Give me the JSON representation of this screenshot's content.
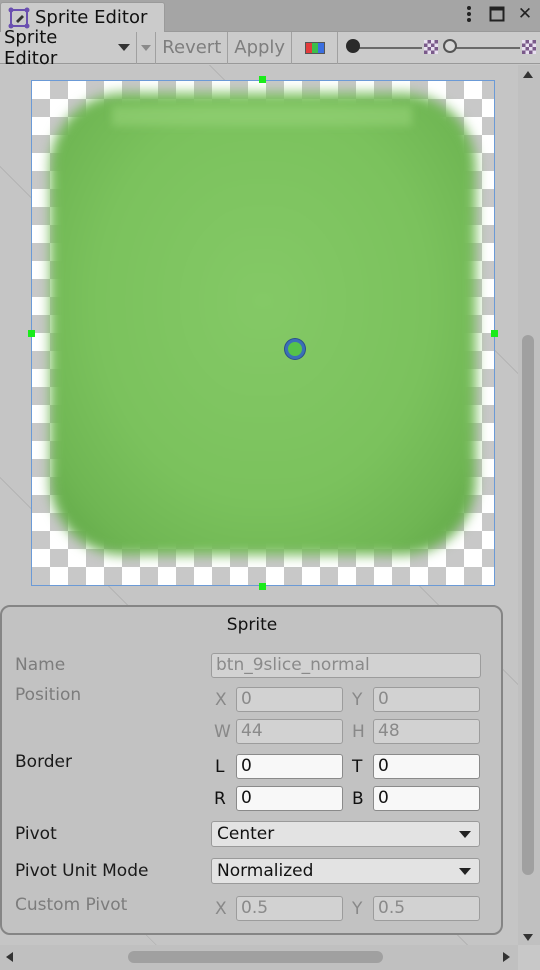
{
  "window": {
    "tab_title": "Sprite Editor",
    "icons": [
      "sprite-editor-icon",
      "more-options-icon",
      "maximize-icon",
      "close-icon"
    ],
    "close_glyph": "✕",
    "maximize_glyph": "☐"
  },
  "toolbar": {
    "mode_label": "Sprite Editor",
    "revert_label": "Revert",
    "apply_label": "Apply",
    "color_channel_icon": "rgb-channels-icon",
    "zoom_icon": "checker-alpha-icon",
    "mip_icon": "checker-mip-icon"
  },
  "canvas": {
    "sprite_color": "#7bc25d",
    "selection_color": "#6b9ad6",
    "handle_color": "#1aeb1a"
  },
  "inspector": {
    "title": "Sprite",
    "name": {
      "label": "Name",
      "value": "btn_9slice_normal"
    },
    "position": {
      "label": "Position",
      "x_label": "X",
      "x": "0",
      "y_label": "Y",
      "y": "0",
      "w_label": "W",
      "w": "44",
      "h_label": "H",
      "h": "48"
    },
    "border": {
      "label": "Border",
      "l_label": "L",
      "l": "0",
      "t_label": "T",
      "t": "0",
      "r_label": "R",
      "r": "0",
      "b_label": "B",
      "b": "0"
    },
    "pivot": {
      "label": "Pivot",
      "value": "Center"
    },
    "pivot_unit_mode": {
      "label": "Pivot Unit Mode",
      "value": "Normalized"
    },
    "custom_pivot": {
      "label": "Custom Pivot",
      "x_label": "X",
      "x": "0.5",
      "y_label": "Y",
      "y": "0.5"
    }
  }
}
